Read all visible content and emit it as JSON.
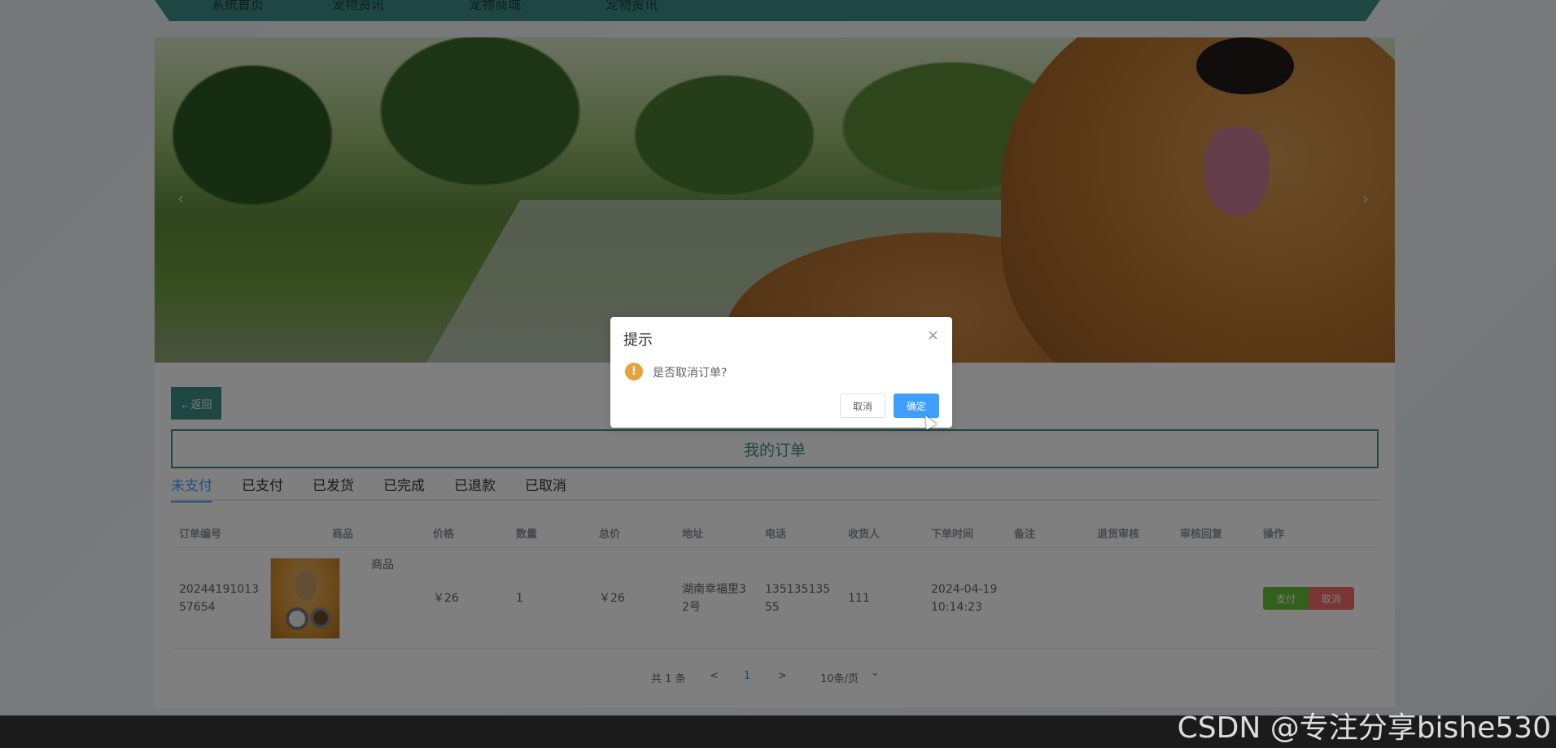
{
  "nav": {
    "items": [
      "系统首页",
      "宠物资讯",
      "宠物商城",
      "宠物资讯"
    ]
  },
  "banner": {
    "prev": "‹",
    "next": "›"
  },
  "content": {
    "back_label": "←返回",
    "title": "我的订单",
    "tabs": [
      "未支付",
      "已支付",
      "已发货",
      "已完成",
      "已退款",
      "已取消"
    ],
    "columns": [
      "订单编号",
      "商品",
      "价格",
      "数量",
      "总价",
      "地址",
      "电话",
      "收货人",
      "下单时间",
      "备注",
      "退货审核",
      "审核回复",
      "操作"
    ],
    "rows": [
      {
        "order_no_1": "20244191013",
        "order_no_2": "57654",
        "product": "商品",
        "price": "￥26",
        "qty": "1",
        "total": "￥26",
        "address_1": "湖南幸福里3",
        "address_2": "2号",
        "phone_1": "135135135",
        "phone_2": "55",
        "receiver": "111",
        "time_1": "2024-04-19",
        "time_2": "10:14:23",
        "pay_label": "支付",
        "cancel_label": "取消"
      }
    ],
    "pager": {
      "total": "共 1 条",
      "prev": "<",
      "page": "1",
      "next": ">",
      "size": "10条/页",
      "size_arrow": "⌄"
    }
  },
  "dialog": {
    "title": "提示",
    "close": "×",
    "warn": "!",
    "message": "是否取消订单?",
    "cancel_label": "取消",
    "ok_label": "确定"
  },
  "watermark": "CSDN @专注分享bishe530",
  "colors": {
    "accent": "#3d8f86",
    "primary": "#409eff",
    "pay": "#67c23a",
    "cancel": "#f56c6c",
    "warning": "#e6a23c"
  }
}
